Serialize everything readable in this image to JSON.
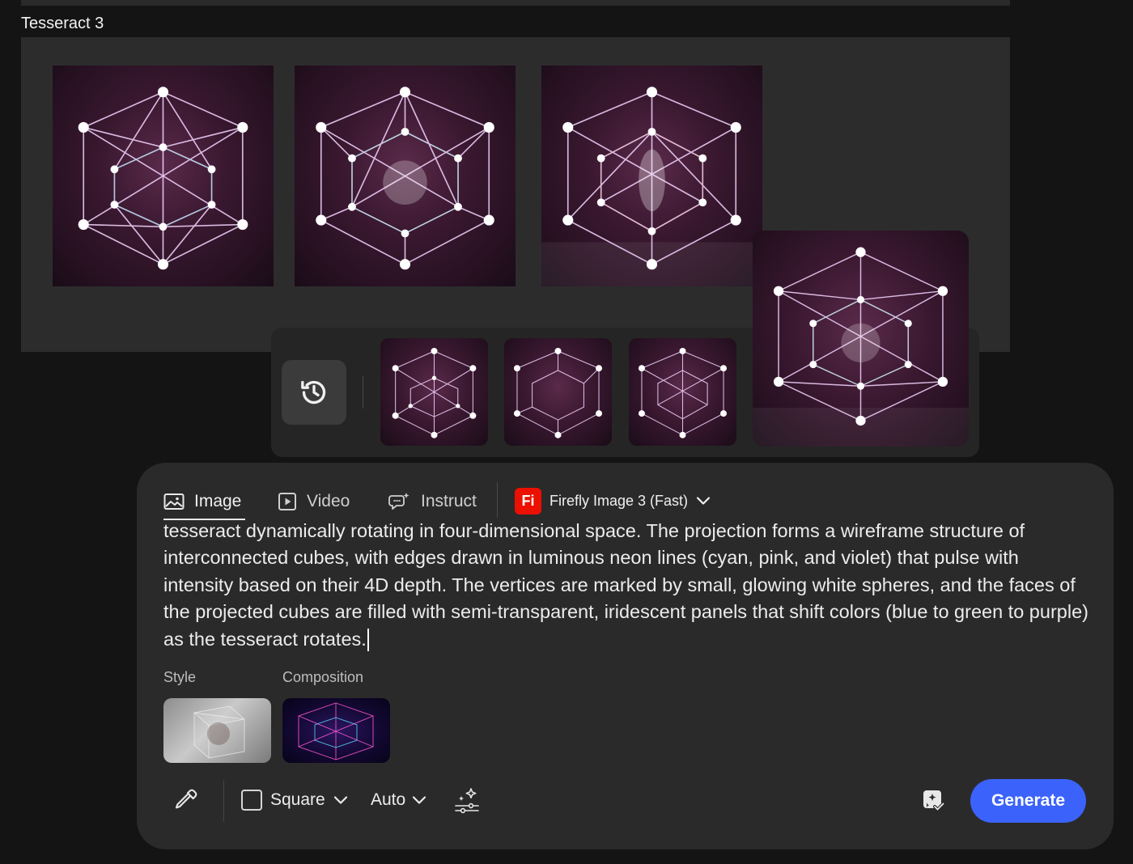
{
  "board": {
    "title": "Tesseract 3"
  },
  "tabs": [
    {
      "label": "Image",
      "icon": "image-icon",
      "active": true
    },
    {
      "label": "Video",
      "icon": "video-icon",
      "active": false
    },
    {
      "label": "Instruct",
      "icon": "instruct-icon",
      "active": false
    }
  ],
  "model": {
    "badge": "Fi",
    "name": "Firefly Image 3 (Fast)",
    "icon": "chevron-down-icon"
  },
  "prompt": {
    "text": "tesseract dynamically rotating in four-dimensional space. The projection forms a wireframe structure of interconnected cubes, with edges drawn in luminous neon lines (cyan, pink, and violet) that pulse with intensity based on their 4D depth. The vertices are marked by small, glowing white spheres, and the faces of the projected cubes are filled with semi-transparent, iridescent panels that shift colors (blue to green to purple) as the tesseract rotates."
  },
  "references": {
    "style_label": "Style",
    "composition_label": "Composition"
  },
  "toolbar": {
    "aspect_label": "Square",
    "auto_label": "Auto",
    "generate_label": "Generate"
  },
  "colors": {
    "accent": "#3b63fb",
    "brand": "#eb1000",
    "panel": "#2a2a2a",
    "background": "#141414"
  }
}
